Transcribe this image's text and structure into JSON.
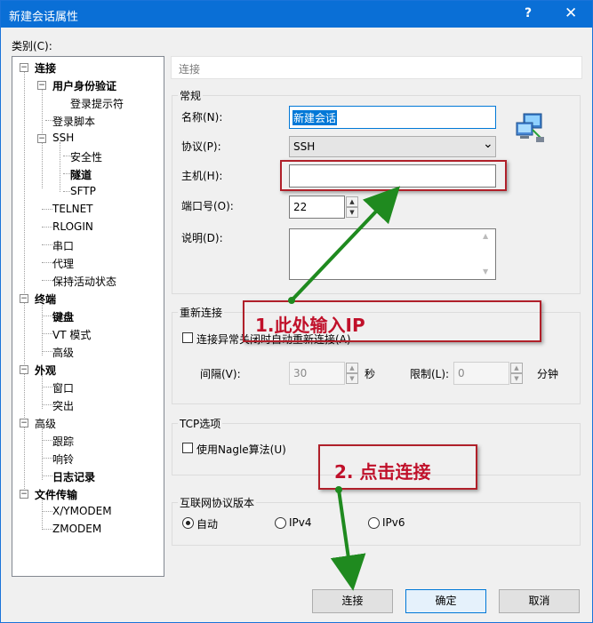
{
  "window": {
    "title": "新建会话属性",
    "help": "?",
    "close": "✕"
  },
  "category_label": "类别(C):",
  "tree": {
    "connect": "连接",
    "user_auth": "用户身份验证",
    "login_prompt": "登录提示符",
    "login_script": "登录脚本",
    "ssh": "SSH",
    "security": "安全性",
    "tunnel": "隧道",
    "sftp": "SFTP",
    "telnet": "TELNET",
    "rlogin": "RLOGIN",
    "serial": "串口",
    "proxy": "代理",
    "keepalive": "保持活动状态",
    "terminal": "终端",
    "keyboard": "键盘",
    "vt_mode": "VT 模式",
    "advanced": "高级",
    "appearance": "外观",
    "window": "窗口",
    "highlight": "突出",
    "advanced2": "高级",
    "trace": "跟踪",
    "bell": "响铃",
    "logging": "日志记录",
    "file_transfer": "文件传输",
    "xymodem": "X/YMODEM",
    "zmodem": "ZMODEM",
    "expand_minus": "−"
  },
  "header": "连接",
  "general": {
    "title": "常规",
    "name_label": "名称(N):",
    "name_value": "新建会话",
    "protocol_label": "协议(P):",
    "protocol_value": "SSH",
    "host_label": "主机(H):",
    "host_value": "",
    "port_label": "端口号(O):",
    "port_value": "22",
    "desc_label": "说明(D):",
    "desc_value": ""
  },
  "reconnect": {
    "title": "重新连接",
    "checkbox_label": "连接异常关闭时自动重新连接(A)",
    "interval_label": "间隔(V):",
    "interval_value": "30",
    "seconds": "秒",
    "limit_label": "限制(L):",
    "limit_value": "0",
    "minutes": "分钟"
  },
  "tcp": {
    "title": "TCP选项",
    "nagle_label": "使用Nagle算法(U)"
  },
  "ip_version": {
    "title": "互联网协议版本",
    "auto": "自动",
    "ipv4": "IPv4",
    "ipv6": "IPv6",
    "selected": "自动"
  },
  "buttons": {
    "connect": "连接",
    "ok": "确定",
    "cancel": "取消"
  },
  "annotations": {
    "step1": "1.此处输入IP",
    "step2": "2. 点击连接",
    "color": "#c0102a",
    "arrow_color": "#1f8a1f"
  },
  "icons": {
    "spin_up": "▲",
    "spin_down": "▼",
    "dropdown": "⌄"
  }
}
